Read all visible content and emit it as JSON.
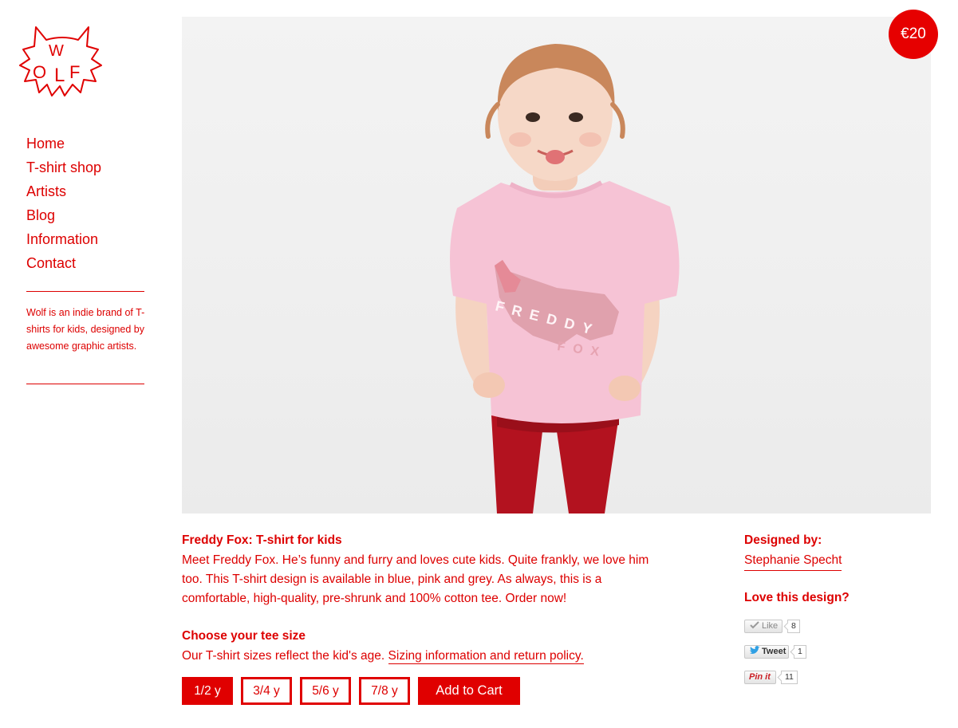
{
  "brand": {
    "logo_text": "WOLF"
  },
  "nav": {
    "items": [
      {
        "label": "Home"
      },
      {
        "label": "T-shirt shop"
      },
      {
        "label": "Artists"
      },
      {
        "label": "Blog"
      },
      {
        "label": "Information"
      },
      {
        "label": "Contact"
      }
    ]
  },
  "sidebar": {
    "tagline": "Wolf is an indie brand of T-shirts for kids, designed by awesome graphic artists."
  },
  "product": {
    "price": "€20",
    "shirt_print": [
      "FREDDY",
      "FOX"
    ],
    "title": "Freddy Fox: T-shirt for kids",
    "description": "Meet Freddy Fox. He’s funny and furry and loves cute kids. Quite frankly, we love him too. This T-shirt design is available in blue, pink and grey. As always, this is a comfortable, high-quality, pre-shrunk and 100% cotton tee. Order now!",
    "size_heading": "Choose your tee size",
    "size_note": "Our T-shirt sizes reflect the kid's age.",
    "size_link": "Sizing information and return policy.",
    "sizes": [
      "1/2 y",
      "3/4 y",
      "5/6 y",
      "7/8 y"
    ],
    "selected_size": "1/2 y",
    "add_to_cart": "Add to Cart"
  },
  "designer": {
    "label": "Designed by:",
    "name": "Stephanie Specht",
    "love_label": "Love this design?"
  },
  "social": {
    "like": {
      "label": "Like",
      "count": "8"
    },
    "tweet": {
      "label": "Tweet",
      "count": "1"
    },
    "pin": {
      "label": "Pin it",
      "count": "11"
    }
  },
  "colors": {
    "accent": "#e00000",
    "text": "#dd0000",
    "background": "#ffffff",
    "photo_bg": "#efefef",
    "shirt": "#f6c3d5",
    "pants": "#b3121f"
  }
}
